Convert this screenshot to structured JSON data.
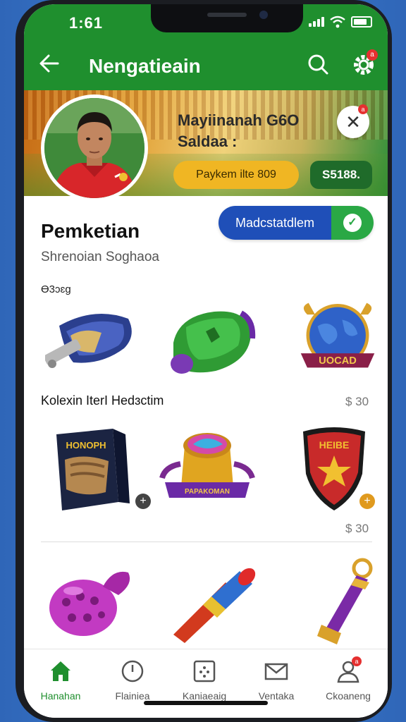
{
  "status": {
    "time": "1:61"
  },
  "appbar": {
    "title": "Nengatieain",
    "back_icon": "arrow-left-icon",
    "search_icon": "search-icon",
    "settings_icon": "gear-icon",
    "settings_badge": "a"
  },
  "banner": {
    "title_line1": "Mayiinanah G6O",
    "title_line2": "Saldaa  :",
    "promo_label": "Paykem ilte 809",
    "price_label": "S5188.",
    "close_badge": "a"
  },
  "profile": {
    "name": "Pemketian",
    "subtitle": "Shrenoian Soghaoa"
  },
  "toggle": {
    "label": "Madcstatdlem",
    "checked": true
  },
  "sections": {
    "first_label": "Ɵ3ɔɛg",
    "second_label": "Kolexin IterI Hedɜctim",
    "second_price": "$ 30",
    "row_price": "$ 30"
  },
  "items_row1": [
    {
      "name": "blue-shoe-cannon"
    },
    {
      "name": "green-glove"
    },
    {
      "name": "blue-globe-badge",
      "ribbon": "UOCAD"
    }
  ],
  "items_row2": [
    {
      "name": "box-item",
      "box_title": "HONOPH"
    },
    {
      "name": "golden-drum",
      "ribbon": "PAPAKOMAN"
    },
    {
      "name": "red-shield-badge",
      "shield_text": "HEIBE"
    }
  ],
  "items_row3": [
    {
      "name": "purple-ball"
    },
    {
      "name": "torch-cone"
    },
    {
      "name": "golden-bat"
    }
  ],
  "bottom_nav": [
    {
      "label": "Hanahan",
      "icon": "home-icon",
      "active": true
    },
    {
      "label": "Flainiea",
      "icon": "clock-icon",
      "active": false
    },
    {
      "label": "Kaniaeaig",
      "icon": "grid-icon",
      "active": false
    },
    {
      "label": "Ventaka",
      "icon": "mail-icon",
      "active": false
    },
    {
      "label": "Ckoaneng",
      "icon": "profile-icon",
      "active": false,
      "badge": "a"
    }
  ],
  "colors": {
    "primary": "#1f8f2e",
    "toggle_blue": "#1f4fb8",
    "promo_yellow": "#f0b623"
  }
}
